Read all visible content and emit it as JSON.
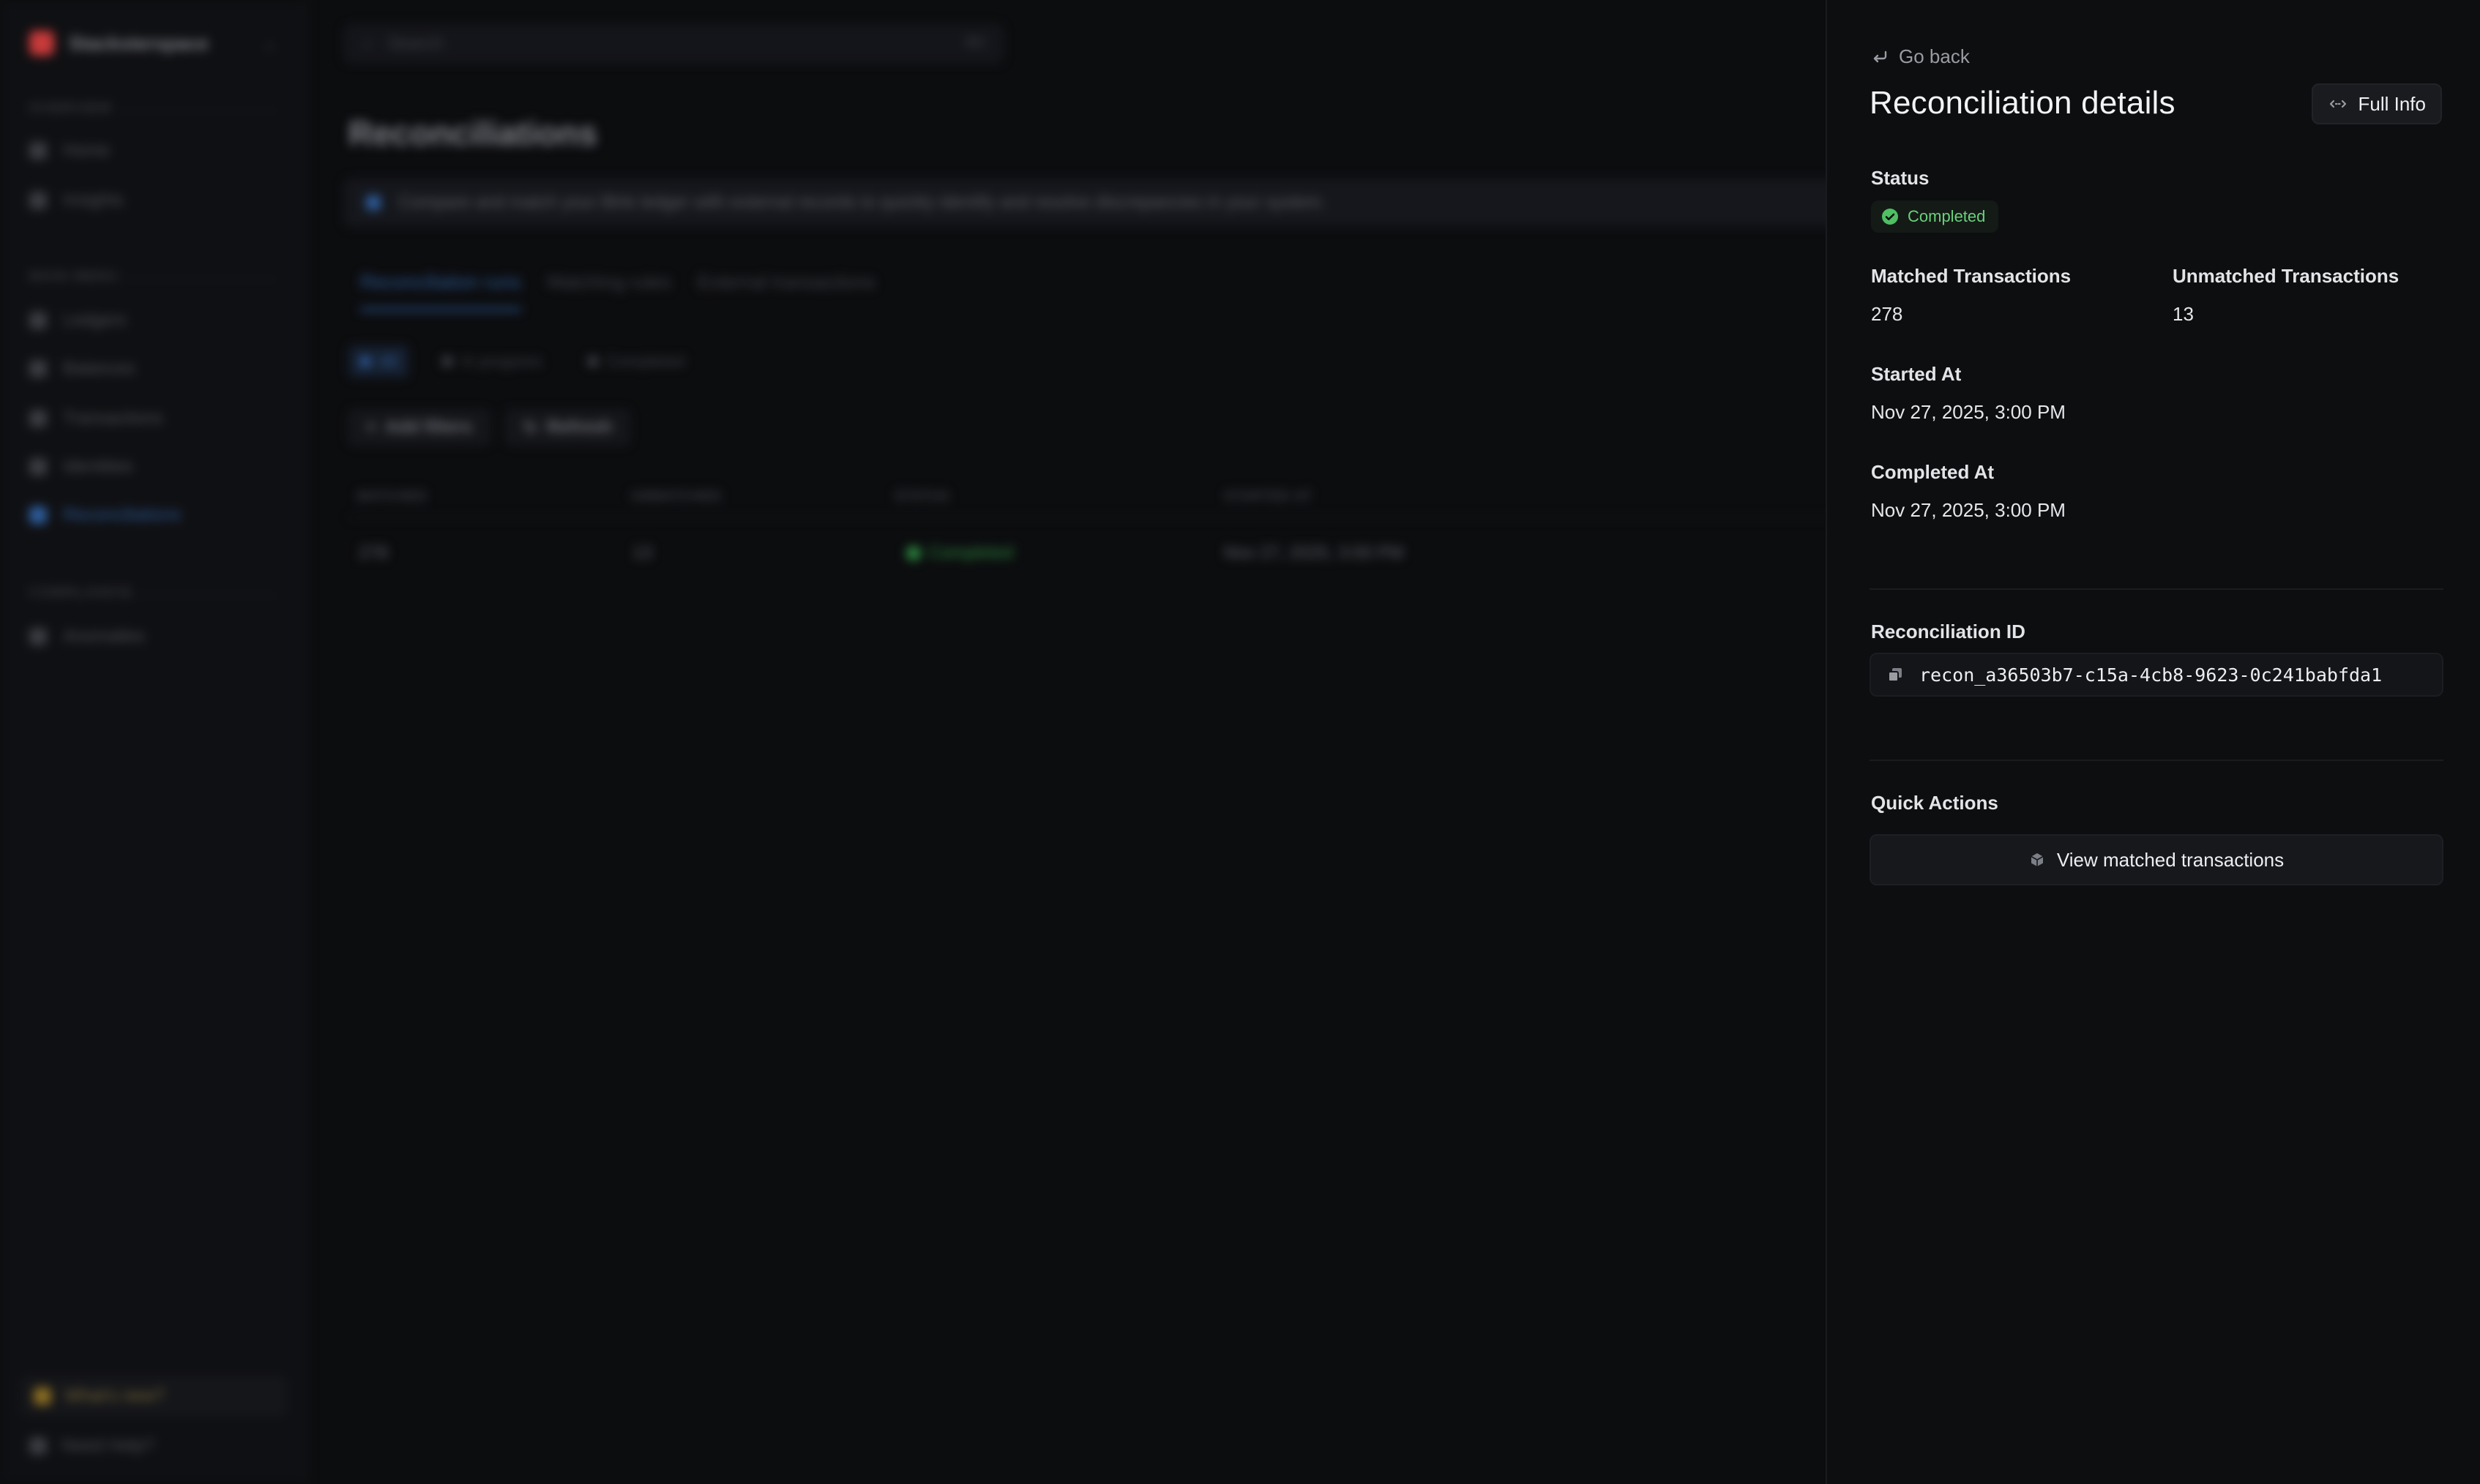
{
  "background": {
    "brand": "Stacksterspace",
    "search_placeholder": "Search",
    "search_shortcut": "⌘K",
    "sections": [
      "OVERVIEW",
      "MAIN MENU",
      "COMPLIANCE"
    ],
    "nav": [
      "Home",
      "Insights",
      "Ledgers",
      "Balances",
      "Transactions",
      "Identities",
      "Reconciliations",
      "Anomalies"
    ],
    "whats_new": "What's new?",
    "need_help": "Need Help?",
    "page_title": "Reconciliations",
    "banner": "Compare and match your Blnk ledger with external records to quickly identify and resolve discrepancies in your system.",
    "tabs": [
      "Reconciliation runs",
      "Matching rules",
      "External transactions"
    ],
    "chips": [
      "All",
      "In progress",
      "Completed"
    ],
    "actions": [
      "Add filters",
      "Refresh"
    ],
    "table_headers": [
      "MATCHED",
      "UNMATCHED",
      "STATUS",
      "STARTED AT"
    ],
    "row": [
      "278",
      "13",
      "Completed",
      "Nov 27, 2025, 3:00 PM"
    ]
  },
  "panel": {
    "go_back": "Go back",
    "title": "Reconciliation details",
    "full_info": "Full Info",
    "status_label": "Status",
    "status_value": "Completed",
    "matched_label": "Matched Transactions",
    "matched_value": "278",
    "unmatched_label": "Unmatched Transactions",
    "unmatched_value": "13",
    "started_label": "Started At",
    "started_value": "Nov 27, 2025, 3:00 PM",
    "completed_label": "Completed At",
    "completed_value": "Nov 27, 2025, 3:00 PM",
    "id_label": "Reconciliation ID",
    "id_value": "recon_a36503b7-c15a-4cb8-9623-0c241babfda1",
    "quick_actions_label": "Quick Actions",
    "view_matched_button": "View matched transactions"
  },
  "colors": {
    "panel_bg": "#0d0e10",
    "success": "#6ad07c",
    "accent_blue": "#2e5d9c"
  },
  "icons": [
    "go-back-icon",
    "expand-icon",
    "check-circle-icon",
    "copy-icon",
    "cube-icon"
  ]
}
